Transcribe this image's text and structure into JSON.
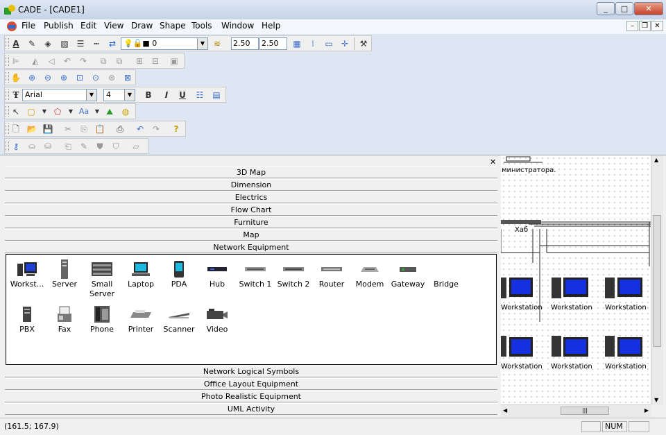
{
  "window": {
    "title": "CADE - [CADE1]"
  },
  "menu": [
    "File",
    "Publish",
    "Edit",
    "View",
    "Draw",
    "Shape",
    "Tools",
    "Window",
    "Help"
  ],
  "toolbar1": {
    "layer_value": "0",
    "width_value": "2.50",
    "height_value": "2.50"
  },
  "toolbar_text": {
    "font_value": "Arial",
    "size_value": "4",
    "bold": "B",
    "italic": "I",
    "underline": "U",
    "text_style": "Aa"
  },
  "categories_top": [
    "3D Map",
    "Dimension",
    "Electrics",
    "Flow Chart",
    "Furniture",
    "Map",
    "Network Equipment"
  ],
  "palette_row1": [
    "Workst...",
    "Server",
    "Small Server",
    "Laptop",
    "PDA",
    "Hub",
    "Switch 1",
    "Switch 2",
    "Router",
    "Modem",
    "Gateway",
    "Bridge"
  ],
  "palette_row2": [
    "PBX",
    "Fax",
    "Phone",
    "Printer",
    "Scanner",
    "Video"
  ],
  "categories_bottom": [
    "Network Logical Symbols",
    "Office Layout Equipment",
    "Photo Realistic Equipment",
    "UML Activity"
  ],
  "canvas": {
    "header_text": "министратора.",
    "hub_label": "Хаб",
    "ws_label": "Workstation"
  },
  "status": {
    "coords": "(161.5; 167.9)",
    "num": "NUM"
  },
  "colors": {
    "accent": "#316ac5",
    "menubar": "#f3f6fb",
    "toolbar_area": "#dfe6f3"
  }
}
